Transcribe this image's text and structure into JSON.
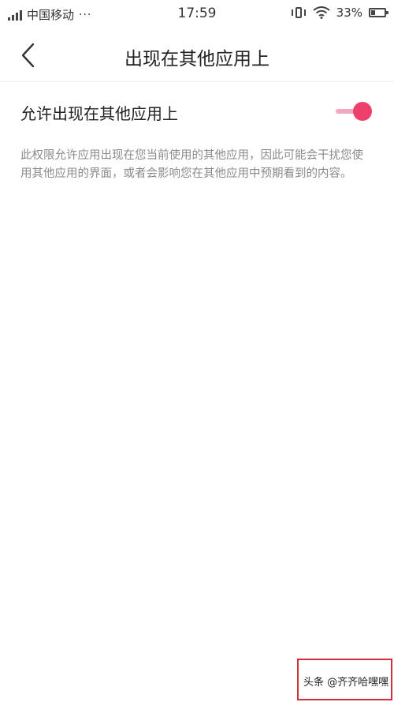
{
  "status_bar": {
    "carrier": "中国移动",
    "dots": "···",
    "time": "17:59",
    "battery": "33%",
    "battery_level": 0.33
  },
  "header": {
    "title": "出现在其他应用上"
  },
  "setting": {
    "label": "允许出现在其他应用上",
    "enabled": true
  },
  "description": "此权限允许应用出现在您当前使用的其他应用，因此可能会干扰您使用其他应用的界面，或者会影响您在其他应用中预期看到的内容。",
  "watermark": {
    "text": "头条 @齐齐哈嘿嘿"
  },
  "colors": {
    "accent": "#ee3f6d",
    "accent_light": "#f2a7bd",
    "description_text": "#8a8a8a",
    "watermark_border": "#d0303a"
  },
  "icons": [
    "signal-icon",
    "vibrate-icon",
    "wifi-icon",
    "battery-icon",
    "back-arrow-icon"
  ]
}
